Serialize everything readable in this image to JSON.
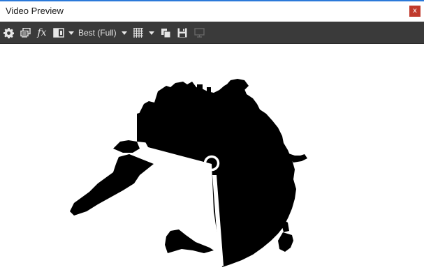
{
  "window": {
    "title": "Video Preview",
    "close_label": "x"
  },
  "toolbar": {
    "quality_label": "Best (Full)",
    "icons": [
      "gear-icon",
      "overlays-icon",
      "fx-icon",
      "split-screen-icon",
      "chevron-down-icon",
      "chevron-down-icon",
      "grid-icon",
      "chevron-down-icon",
      "copy-snapshot-icon",
      "save-snapshot-icon",
      "external-monitor-icon"
    ],
    "fx_label": "fx"
  },
  "colors": {
    "title_accent": "#2b79d9",
    "close_button": "#c0392b",
    "toolbar_bg": "#3a3a3a",
    "preview_bg": "#ffffff",
    "silhouette": "#000000"
  }
}
